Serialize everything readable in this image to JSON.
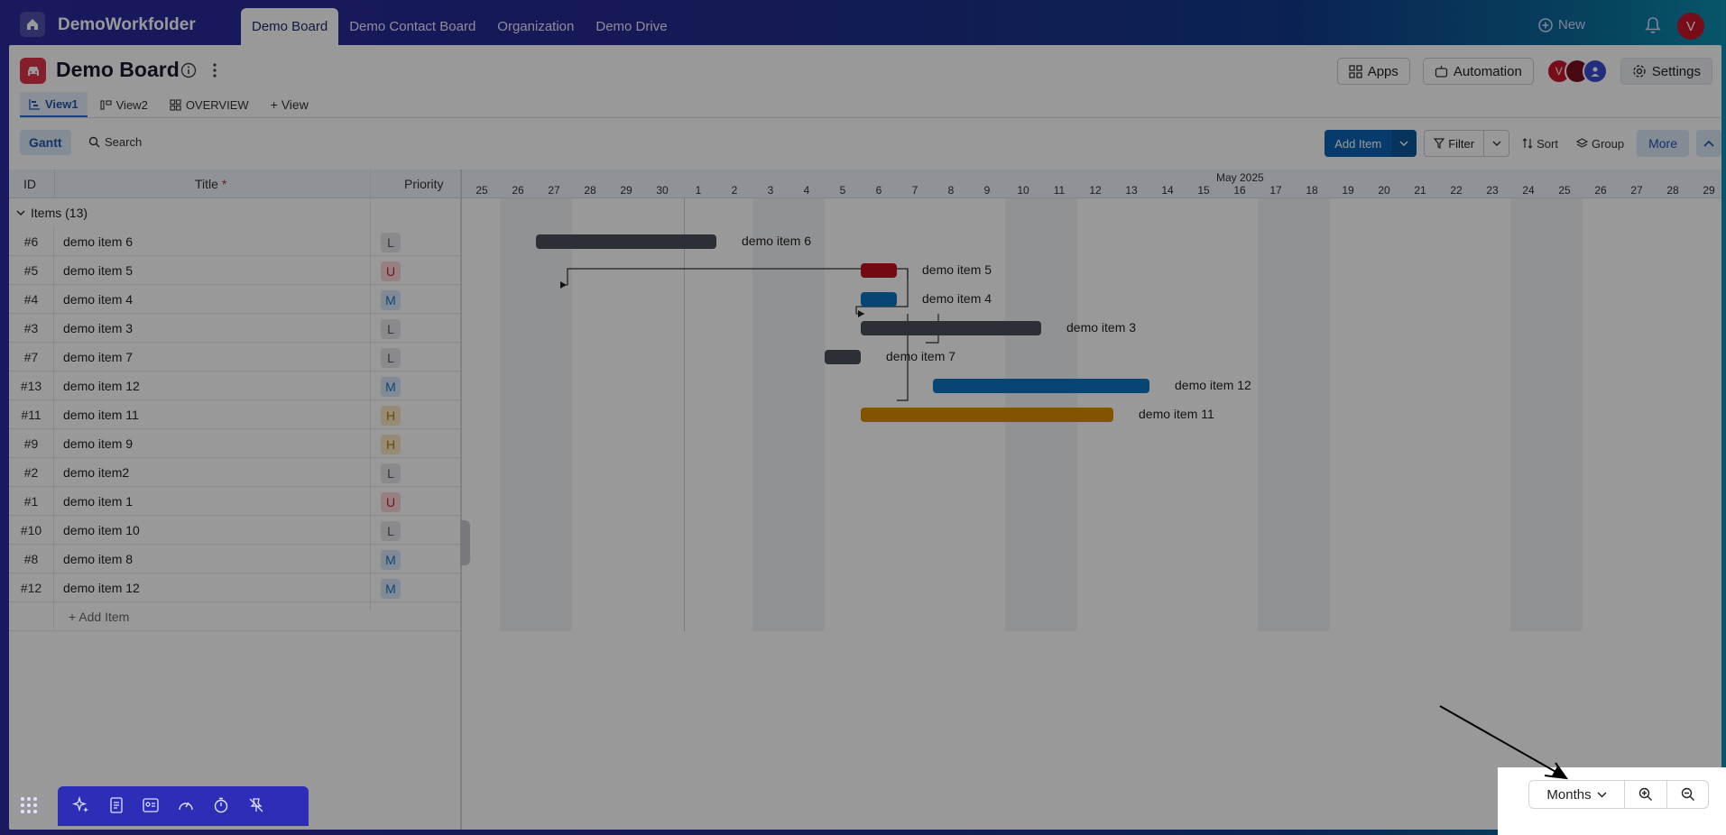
{
  "app": {
    "title": "DemoWorkfolder"
  },
  "nav": {
    "tabs": [
      "Demo Board",
      "Demo Contact Board",
      "Organization",
      "Demo Drive"
    ],
    "new_label": "New",
    "user_initial": "V"
  },
  "board": {
    "title": "Demo Board",
    "actions": {
      "apps": "Apps",
      "automation": "Automation",
      "settings": "Settings"
    },
    "member_initial": "V",
    "views": [
      "View1",
      "View2",
      "OVERVIEW"
    ],
    "add_view": "+ View"
  },
  "toolbar": {
    "gantt": "Gantt",
    "search": "Search",
    "add_item": "Add Item",
    "filter": "Filter",
    "sort": "Sort",
    "group": "Group",
    "more": "More"
  },
  "grid": {
    "headers": {
      "id": "ID",
      "title": "Title",
      "required": "*",
      "priority": "Priority"
    },
    "group_label": "Items (13)",
    "rows": [
      {
        "id": "#6",
        "title": "demo item 6",
        "priority": "L"
      },
      {
        "id": "#5",
        "title": "demo item 5",
        "priority": "U"
      },
      {
        "id": "#4",
        "title": "demo item 4",
        "priority": "M"
      },
      {
        "id": "#3",
        "title": "demo item 3",
        "priority": "L"
      },
      {
        "id": "#7",
        "title": "demo item 7",
        "priority": "L"
      },
      {
        "id": "#13",
        "title": "demo item 12",
        "priority": "M"
      },
      {
        "id": "#11",
        "title": "demo item 11",
        "priority": "H"
      },
      {
        "id": "#9",
        "title": "demo item 9",
        "priority": "H"
      },
      {
        "id": "#2",
        "title": "demo item2",
        "priority": "L"
      },
      {
        "id": "#1",
        "title": "demo item 1",
        "priority": "U"
      },
      {
        "id": "#10",
        "title": "demo item 10",
        "priority": "L"
      },
      {
        "id": "#8",
        "title": "demo item 8",
        "priority": "M"
      },
      {
        "id": "#12",
        "title": "demo item 12",
        "priority": "M"
      }
    ],
    "add_item": "+ Add Item"
  },
  "timeline": {
    "month": "May 2025",
    "days": [
      "25",
      "26",
      "27",
      "28",
      "29",
      "30",
      "1",
      "2",
      "3",
      "4",
      "5",
      "6",
      "7",
      "8",
      "9",
      "10",
      "11",
      "12",
      "13",
      "14",
      "15",
      "16",
      "17",
      "18",
      "19",
      "20",
      "21",
      "22",
      "23",
      "24",
      "25",
      "26",
      "27",
      "28",
      "29"
    ],
    "bars": [
      {
        "label": "demo item 6",
        "start": "2025-04-27",
        "end": "2025-05-02",
        "color": "#4b4f5c"
      },
      {
        "label": "demo item 5",
        "start": "2025-05-06",
        "end": "2025-05-07",
        "color": "#c0111f"
      },
      {
        "label": "demo item 4",
        "start": "2025-05-06",
        "end": "2025-05-07",
        "color": "#0d73c2"
      },
      {
        "label": "demo item 3",
        "start": "2025-05-06",
        "end": "2025-05-11",
        "color": "#4b4f5c"
      },
      {
        "label": "demo item 7",
        "start": "2025-05-05",
        "end": "2025-05-06",
        "color": "#4b4f5c"
      },
      {
        "label": "demo item 12",
        "start": "2025-05-08",
        "end": "2025-05-14",
        "color": "#0d73c2"
      },
      {
        "label": "demo item 11",
        "start": "2025-05-06",
        "end": "2025-05-13",
        "color": "#d98a00"
      }
    ]
  },
  "zoom": {
    "scale": "Months"
  },
  "priority_colors": {
    "L": {
      "bg": "#e6e7ea",
      "fg": "#555"
    },
    "M": {
      "bg": "#d6e8f8",
      "fg": "#1e6ec0"
    },
    "H": {
      "bg": "#fbe8c4",
      "fg": "#b87400"
    },
    "U": {
      "bg": "#fbd5d8",
      "fg": "#c61b2b"
    }
  },
  "colors": {
    "accent": "#0d63b3",
    "brand_gradient_start": "#2a2a9e",
    "brand_gradient_end": "#0c8fb0"
  }
}
